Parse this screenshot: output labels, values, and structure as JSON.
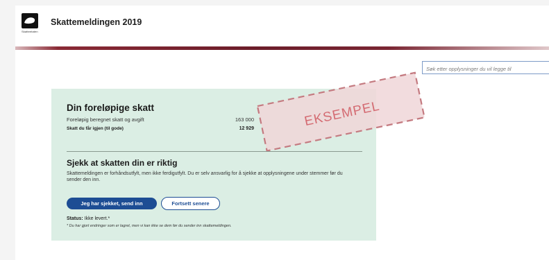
{
  "header": {
    "logo_text": "Skatteetaten",
    "app_title": "Skattemeldingen 2019"
  },
  "search": {
    "placeholder": "Søk etter opplysninger du vil legge til"
  },
  "card": {
    "title": "Din foreløpige skatt",
    "rows": [
      {
        "label": "Foreløpig beregnet skatt og avgift",
        "value": "163 000"
      },
      {
        "label": "Skatt du får igjen (til gode)",
        "value": "12 929"
      }
    ],
    "check_title": "Sjekk at skatten din er riktig",
    "check_description": "Skattemeldingen er forhåndsutfylt, men ikke ferdigutfylt. Du er selv ansvarlig for å sjekke at opplysningene under stemmer før du sender den inn.",
    "primary_button": "Jeg har sjekket, send inn",
    "secondary_button": "Fortsett senere",
    "status_label": "Status:",
    "status_value": "Ikke levert.*",
    "status_note": "* Du har gjort endringer som er lagret, men vi kan ikke se dem før du sender inn skattemeldingen."
  },
  "stamp": {
    "text": "EKSEMPEL",
    "color": "#d46b72"
  }
}
